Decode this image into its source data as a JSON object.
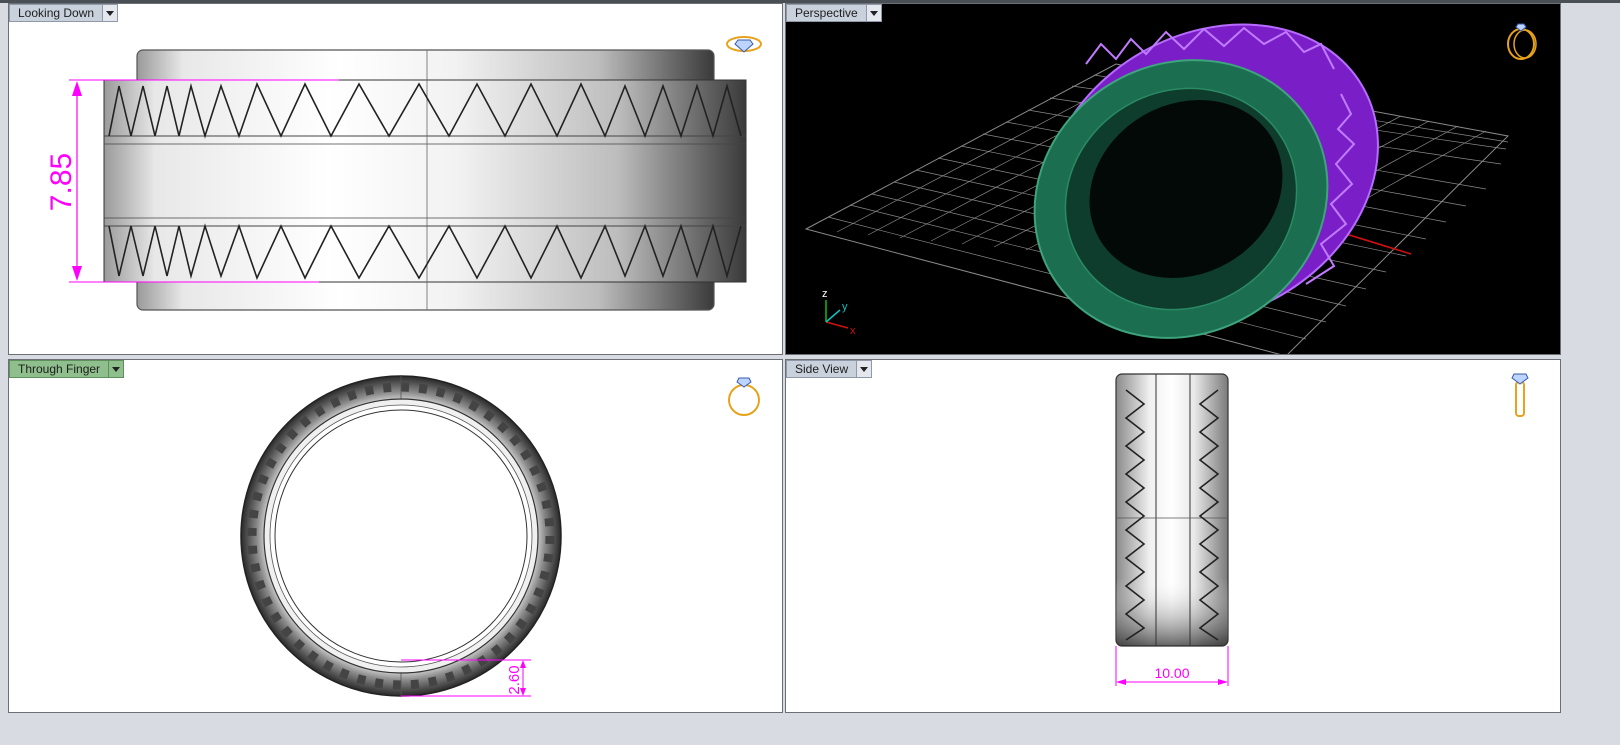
{
  "viewports": {
    "top_left": {
      "label": "Looking Down",
      "dimension": "7.85"
    },
    "top_right": {
      "label": "Perspective",
      "axes": {
        "z": "z",
        "y": "y",
        "x": "x"
      }
    },
    "bottom_left": {
      "label": "Through Finger",
      "dimension": "2.60"
    },
    "bottom_right": {
      "label": "Side View",
      "dimension": "10.00"
    }
  },
  "colors": {
    "dimension": "#ff00ff",
    "ring_body": "#1e7a5a",
    "ring_gems": "#8a1fd6",
    "grid": "#9a9a9a",
    "x_axis": "#d01010",
    "y_axis": "#10c0c0",
    "active_tab": "#8fbf8c",
    "view_icon": "#e8a21c"
  },
  "icons": [
    "ring-top-icon",
    "ring-perspective-icon",
    "ring-front-icon",
    "ring-side-icon"
  ]
}
